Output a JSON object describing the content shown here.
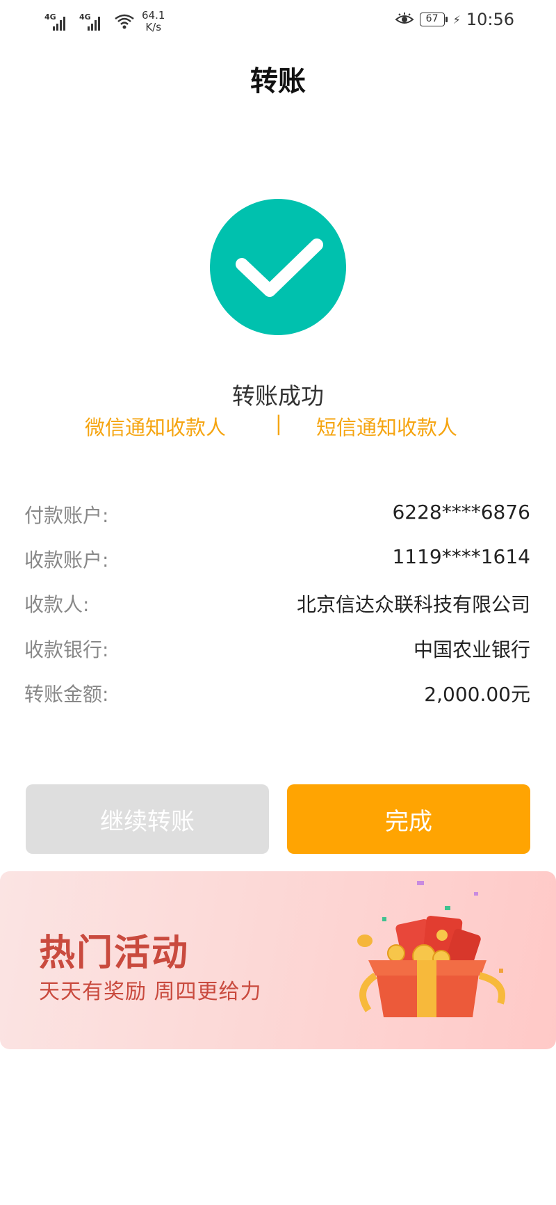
{
  "status_bar": {
    "network1": "4G",
    "network2": "4G",
    "speed_value": "64.1",
    "speed_unit": "K/s",
    "battery": "67",
    "time": "10:56"
  },
  "header": {
    "title": "转账"
  },
  "result": {
    "status": "转账成功",
    "notify_wechat": "微信通知收款人",
    "separator": "|",
    "notify_sms": "短信通知收款人"
  },
  "details": [
    {
      "label": "付款账户:",
      "value": "6228****6876"
    },
    {
      "label": "收款账户:",
      "value": "1119****1614"
    },
    {
      "label": "收款人:",
      "value": "北京信达众联科技有限公司"
    },
    {
      "label": "收款银行:",
      "value": "中国农业银行"
    },
    {
      "label": "转账金额:",
      "value": "2,000.00元"
    }
  ],
  "buttons": {
    "continue": "继续转账",
    "done": "完成"
  },
  "banner": {
    "title": "热门活动",
    "subtitle": "天天有奖励  周四更给力"
  },
  "colors": {
    "accent": "#ffa402",
    "success": "#00c1ae",
    "link": "#f5a512",
    "banner_text": "#c94a3e"
  }
}
